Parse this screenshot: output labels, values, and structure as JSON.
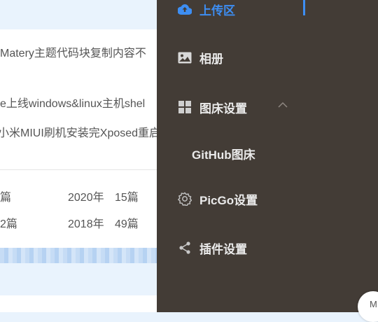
{
  "page": {
    "posts": [
      "Matery主题代码块复制内容不",
      "e上线windows&linux主机shel",
      "小米MIUI刷机安装完Xposed重启"
    ],
    "archive": [
      {
        "left": "篇",
        "year": "2020年",
        "count": "15篇"
      },
      {
        "left": "2篇",
        "year": "2018年",
        "count": "49篇"
      }
    ]
  },
  "menu": {
    "upload": "上传区",
    "album": "相册",
    "bed_settings": "图床设置",
    "github": "GitHub图床",
    "picgo": "PicGo设置",
    "plugins": "插件设置",
    "corner": "M",
    "accent": "#3d8ef3"
  }
}
